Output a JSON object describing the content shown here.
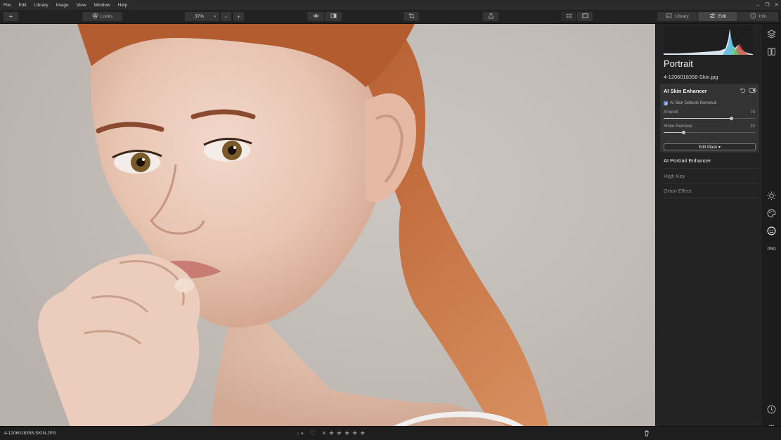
{
  "menu": [
    "File",
    "Edit",
    "Library",
    "Image",
    "View",
    "Window",
    "Help"
  ],
  "window_controls": [
    "–",
    "❐",
    "✕"
  ],
  "toolbar": {
    "add_label": "+",
    "looks_label": "Looks",
    "zoom_value": "37%",
    "zoom_minus": "−",
    "zoom_plus": "+",
    "tabs": [
      {
        "label": "Library",
        "icon": "library-icon"
      },
      {
        "label": "Edit",
        "icon": "sliders-icon"
      },
      {
        "label": "Info",
        "icon": "info-icon"
      }
    ],
    "active_tab": "Edit"
  },
  "panel": {
    "title": "Portrait",
    "file_name": "4-1206018358-Skin.jpg",
    "card": {
      "title": "AI Skin Enhancer",
      "checkbox_label": "AI Skin Defects Removal",
      "checkbox_checked": true,
      "sliders": [
        {
          "label": "Amount",
          "value": "74",
          "fraction": 0.74
        },
        {
          "label": "Shine Removal",
          "value": "22",
          "fraction": 0.22
        }
      ],
      "edit_mask_label": "Edit Mask ▾"
    },
    "sections": [
      {
        "label": "AI Portrait Enhancer",
        "enabled": true
      },
      {
        "label": "High Key",
        "enabled": false
      },
      {
        "label": "Orton Effect",
        "enabled": false
      }
    ]
  },
  "rail_icons": [
    "layers-icon",
    "compare-icon",
    "sun-icon",
    "palette-icon",
    "face-icon",
    "pro-icon",
    "history-icon",
    "more-icon"
  ],
  "rail_pro_label": "PRO",
  "rail_more_label": "•••",
  "status": {
    "file_name": "4-1206018358-SKIN.JPG",
    "circle_label": "○ ▾",
    "heart_label": "♡",
    "reject_label": "✕",
    "rating_stars": [
      "★",
      "★",
      "★",
      "★",
      "★"
    ]
  },
  "colors": {
    "accent": "#6d8fd1",
    "panel_bg": "#232323",
    "card_bg": "#333333"
  }
}
